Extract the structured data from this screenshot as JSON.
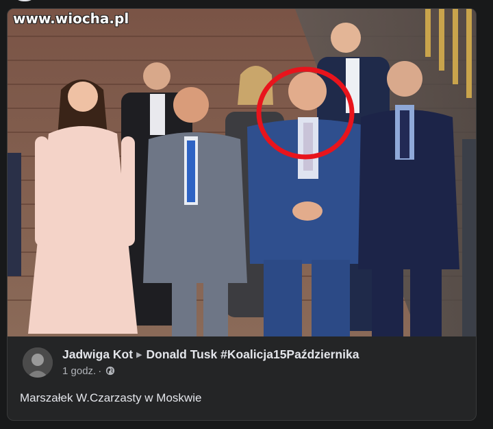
{
  "watermark": {
    "text": "www.wiocha.pl"
  },
  "post": {
    "author": "Jadwiga Kot",
    "target": "Donald Tusk #Koalicja15Października",
    "time": "1 godz.",
    "separator": "·",
    "privacy_icon": "globe-icon",
    "text": "Marszałek W.Czarzasty w Moskwie"
  },
  "colors": {
    "page_bg": "#18191a",
    "card_bg": "#242526",
    "primary_text": "#e4e6eb",
    "secondary_text": "#b0b3b8",
    "highlight_circle": "#e8141c"
  }
}
